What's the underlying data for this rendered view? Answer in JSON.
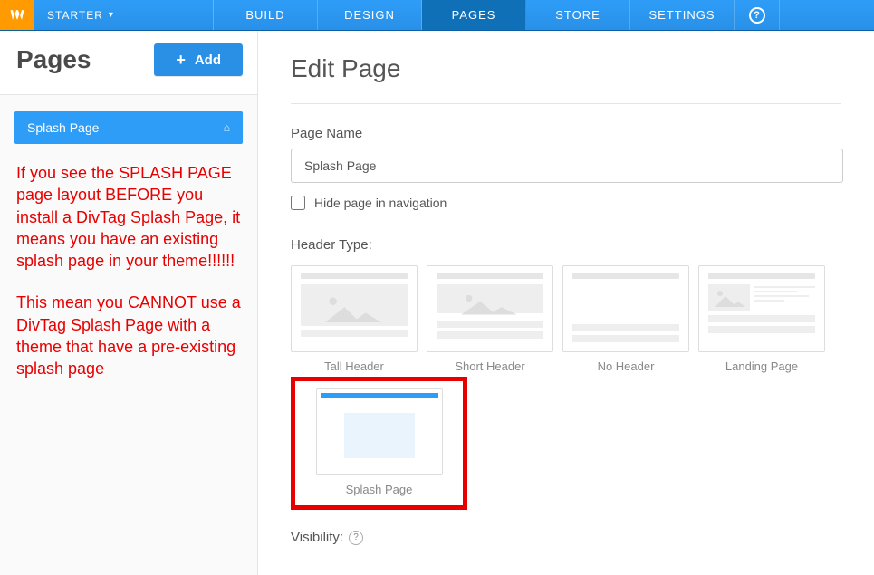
{
  "topbar": {
    "plan": "STARTER",
    "tabs": [
      "BUILD",
      "DESIGN",
      "PAGES",
      "STORE",
      "SETTINGS"
    ],
    "active_tab_index": 2
  },
  "sidebar": {
    "title": "Pages",
    "add_label": "Add",
    "page_item": "Splash Page",
    "annotation_p1": "If you see the SPLASH PAGE page layout BEFORE you install a DivTag Splash Page, it means you have an existing splash page in your theme!!!!!!",
    "annotation_p2": "This mean you CANNOT use a DivTag Splash Page with a theme that have a pre-existing splash page"
  },
  "content": {
    "heading": "Edit Page",
    "page_name_label": "Page Name",
    "page_name_value": "Splash Page",
    "hide_nav_label": "Hide page in navigation",
    "header_type_label": "Header Type:",
    "header_types": [
      "Tall Header",
      "Short Header",
      "No Header",
      "Landing Page"
    ],
    "splash_label": "Splash Page",
    "visibility_label": "Visibility:"
  }
}
